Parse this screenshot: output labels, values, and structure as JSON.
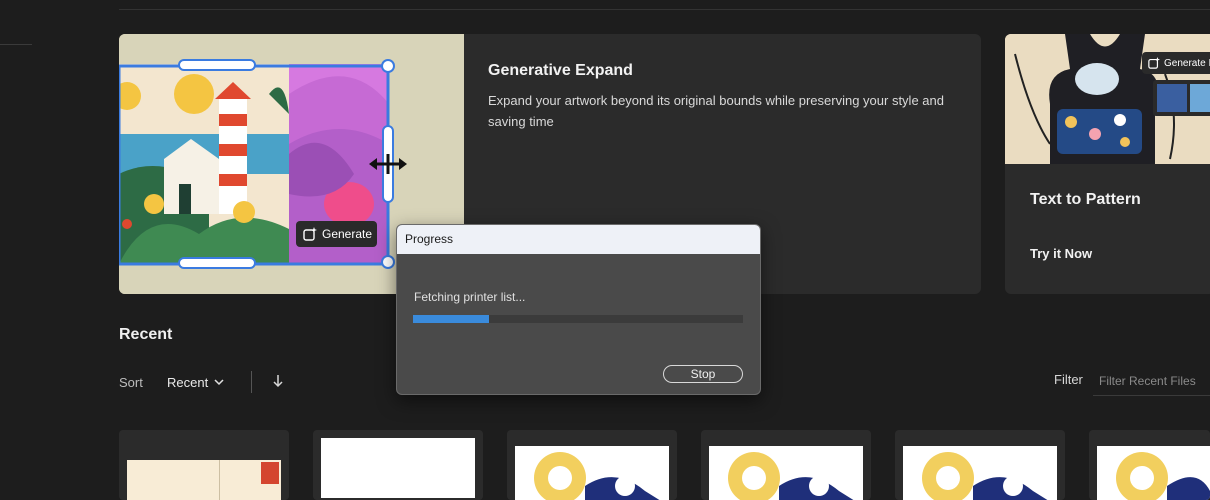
{
  "banner": {
    "generative_expand": {
      "title": "Generative Expand",
      "description": "Expand your artwork beyond its original bounds while preserving your style and saving time",
      "generate_label": "Generate"
    },
    "text_to_pattern": {
      "title": "Text to Pattern",
      "cta": "Try it Now",
      "generate_label": "Generate I"
    }
  },
  "recent": {
    "title": "Recent",
    "sort_label": "Sort",
    "sort_value": "Recent",
    "filter_label": "Filter",
    "filter_placeholder": "Filter Recent Files"
  },
  "dialog": {
    "title": "Progress",
    "status": "Fetching printer list...",
    "progress": 0.23,
    "stop_label": "Stop"
  },
  "colors": {
    "accent": "#3a8bdc",
    "background": "#1d1d1d",
    "card": "#2b2b2b",
    "selection": "#3a7be0"
  },
  "icons": [
    "generate-icon",
    "chevron-down-icon",
    "sort-direction-icon",
    "resize-cursor-icon"
  ]
}
